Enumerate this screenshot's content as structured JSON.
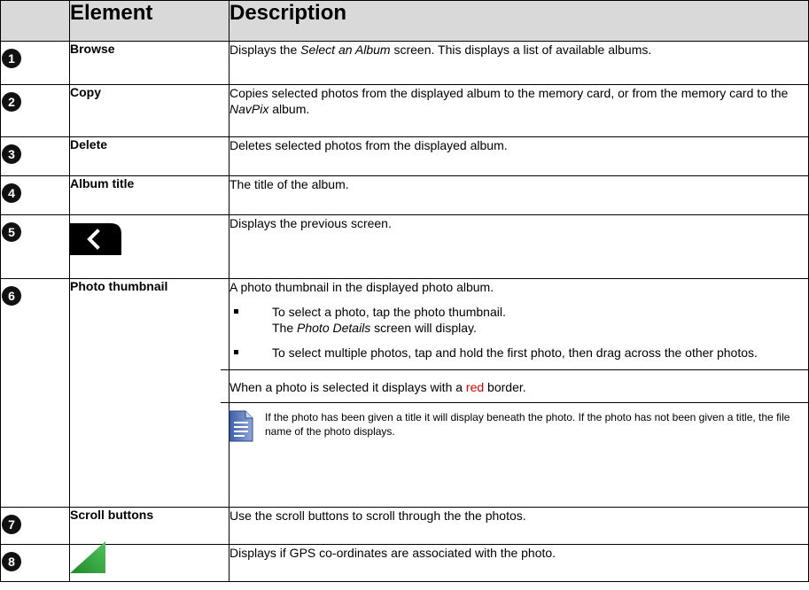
{
  "header": {
    "element": "Element",
    "description": "Description"
  },
  "rows": [
    {
      "num": "1",
      "element": "Browse",
      "desc_a": "Displays the ",
      "desc_i1": "Select an Album",
      "desc_b": " screen. This displays a list of available albums."
    },
    {
      "num": "2",
      "element": "Copy",
      "desc_a": "Copies selected photos from the displayed album to the memory card, or from the memory card to the ",
      "desc_i1": "NavPix",
      "desc_b": " album."
    },
    {
      "num": "3",
      "element": "Delete",
      "desc": "Deletes selected photos from the displayed album."
    },
    {
      "num": "4",
      "element": "Album title",
      "desc": "The title of the album."
    },
    {
      "num": "5",
      "element_icon": "back-arrow-icon",
      "desc": "Displays  the previous screen."
    },
    {
      "num": "6",
      "element": "Photo thumbnail",
      "desc": "A photo thumbnail in the displayed photo album.",
      "bullets": [
        {
          "line1": "To select a photo, tap the photo thumbnail.",
          "line2_i": "Photo Details",
          "line2_pre": "The ",
          "line2_post": " screen will display."
        },
        {
          "text": "To select multiple photos, tap and hold the first photo, then drag across the other photos."
        }
      ],
      "selected_a": "When a photo is selected it displays with a ",
      "selected_red": "red",
      "selected_b": " border.",
      "note_icon": "note-document-icon",
      "note": "If the photo has been given a title it will display beneath the photo.  If the photo has not been given a title, the file name of the photo displays."
    },
    {
      "num": "7",
      "element": "Scroll buttons",
      "desc": "Use the scroll buttons to scroll through the the photos."
    },
    {
      "num": "8",
      "element_icon": "gps-triangle-icon",
      "desc": "Displays if GPS co-ordinates are associated with the photo."
    }
  ],
  "colors": {
    "header_bg": "#d9d9d9",
    "highlight_red": "#e00000",
    "gps_green": "#2e9e3a"
  }
}
